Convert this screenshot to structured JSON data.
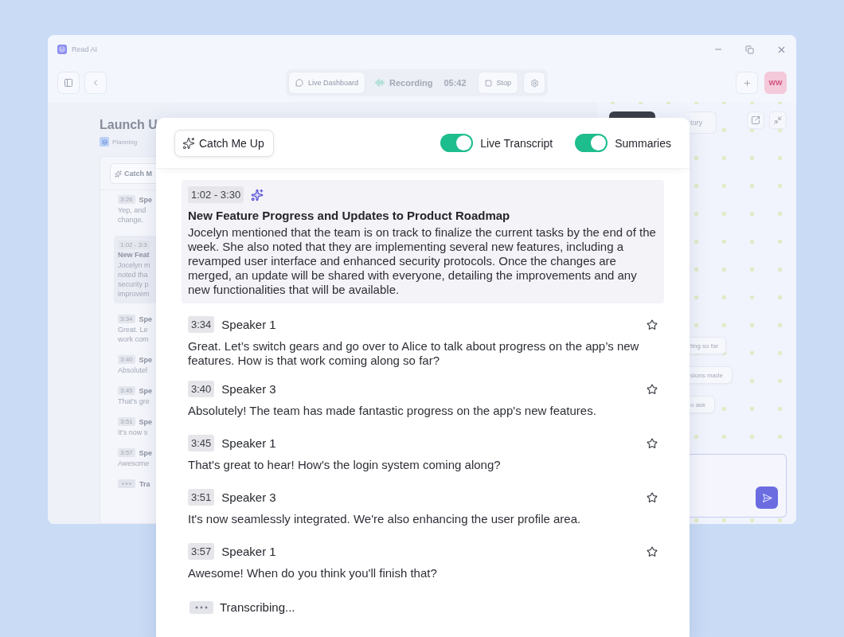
{
  "app": {
    "name": "Read AI"
  },
  "toolbar": {
    "live_dashboard": "Live Dashboard",
    "recording_label": "Recording",
    "recording_time": "05:42",
    "stop": "Stop",
    "avatar": "WW"
  },
  "background": {
    "title": "Launch U",
    "tag": "Planning",
    "catch_button": "Catch M",
    "entries": [
      {
        "kind": "line",
        "time": "3:26",
        "speaker": "Spe",
        "lines": [
          "Yep, and",
          "change."
        ]
      },
      {
        "kind": "summary",
        "time": "1:02 - 3:3",
        "title": "New Feat",
        "lines": [
          "Jocelyn m",
          "noted tha",
          "security p",
          "improvem"
        ]
      },
      {
        "kind": "line",
        "time": "3:34",
        "speaker": "Spe",
        "lines": [
          "Great. Le",
          "work com"
        ]
      },
      {
        "kind": "line",
        "time": "3:40",
        "speaker": "Spe",
        "lines": [
          "Absolutel"
        ]
      },
      {
        "kind": "line",
        "time": "3:45",
        "speaker": "Spe",
        "lines": [
          "That's gre"
        ]
      },
      {
        "kind": "line",
        "time": "3:51",
        "speaker": "Spe",
        "lines": [
          "It's now s"
        ]
      },
      {
        "kind": "line",
        "time": "3:57",
        "speaker": "Spe",
        "lines": [
          "Awesome"
        ]
      },
      {
        "kind": "pending",
        "speaker": "Tra"
      }
    ]
  },
  "side_panel": {
    "tab": "tory",
    "suggestions": [
      "ting so far",
      "sions made",
      "o ask"
    ]
  },
  "transcript_panel": {
    "catch_me_up": "Catch Me Up",
    "toggles": [
      {
        "label": "Live Transcript",
        "on": true
      },
      {
        "label": "Summaries",
        "on": true
      }
    ],
    "items": [
      {
        "kind": "summary",
        "time": "1:02 - 3:30",
        "title": "New Feature Progress and Updates to Product Roadmap",
        "text": "Jocelyn mentioned that the team is on track to finalize the current tasks by the end of the week. She also noted that they are implementing several new features, including a revamped user interface and enhanced security protocols. Once the changes are merged, an update will be shared with everyone, detailing the improvements and any new functionalities that will be available."
      },
      {
        "kind": "utterance",
        "time": "3:34",
        "speaker": "Speaker 1",
        "starred": false,
        "text": "Great. Let’s switch gears and go over to Alice to talk about progress on the app’s new features. How is that work coming along so far?"
      },
      {
        "kind": "utterance",
        "time": "3:40",
        "speaker": "Speaker 3",
        "starred": false,
        "text": "Absolutely! The team has made fantastic progress on the app's new features."
      },
      {
        "kind": "utterance",
        "time": "3:45",
        "speaker": "Speaker 1",
        "starred": false,
        "text": "That's great to hear! How's the login system coming along?"
      },
      {
        "kind": "utterance",
        "time": "3:51",
        "speaker": "Speaker 3",
        "starred": false,
        "text": "It's now seamlessly integrated. We're also enhancing the user profile area."
      },
      {
        "kind": "utterance",
        "time": "3:57",
        "speaker": "Speaker 1",
        "starred": false,
        "text": "Awesome! When do you think you'll finish that?"
      }
    ],
    "status": "Transcribing..."
  }
}
